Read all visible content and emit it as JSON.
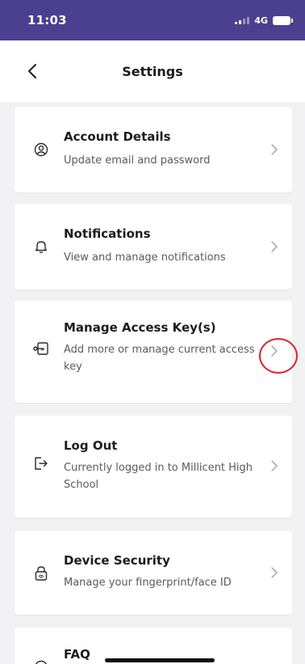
{
  "status_bar": {
    "time": "11:03",
    "network": "4G"
  },
  "header": {
    "title": "Settings"
  },
  "items": [
    {
      "title": "Account Details",
      "subtitle": "Update email and password",
      "icon": "account-circle-icon"
    },
    {
      "title": "Notifications",
      "subtitle": "View and manage notifications",
      "icon": "bell-icon"
    },
    {
      "title": "Manage Access Key(s)",
      "subtitle": "Add more or manage current access key",
      "icon": "access-key-icon"
    },
    {
      "title": "Log Out",
      "subtitle": "Currently logged in to Millicent High School",
      "icon": "logout-icon"
    },
    {
      "title": "Device Security",
      "subtitle": "Manage your fingerprint/face ID",
      "icon": "device-security-icon"
    },
    {
      "title": "FAQ",
      "subtitle": "",
      "icon": "faq-icon"
    }
  ],
  "colors": {
    "status_bar": "#4b3f8f",
    "highlight": "#e0242a"
  }
}
